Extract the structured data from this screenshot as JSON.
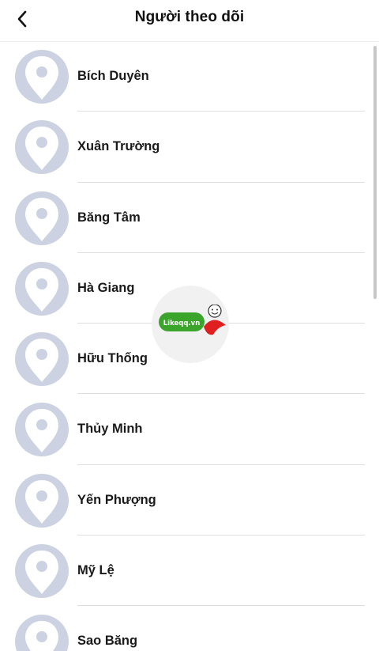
{
  "header": {
    "title": "Người theo dõi",
    "back_icon": "chevron-left-icon"
  },
  "followers": [
    {
      "name": "Bích Duyên"
    },
    {
      "name": "Xuân Trường"
    },
    {
      "name": "Băng Tâm"
    },
    {
      "name": "Hà Giang"
    },
    {
      "name": "Hữu Thống"
    },
    {
      "name": "Thủy Minh"
    },
    {
      "name": "Yến Phượng"
    },
    {
      "name": "Mỹ Lệ"
    },
    {
      "name": "Sao Băng"
    }
  ],
  "avatar_placeholder_icon": "location-pin-icon",
  "colors": {
    "avatar_bg": "#ccd2e2",
    "divider": "#dedede",
    "text": "#1a1a1a"
  },
  "watermark": {
    "brand": "Likeqq.vn"
  }
}
